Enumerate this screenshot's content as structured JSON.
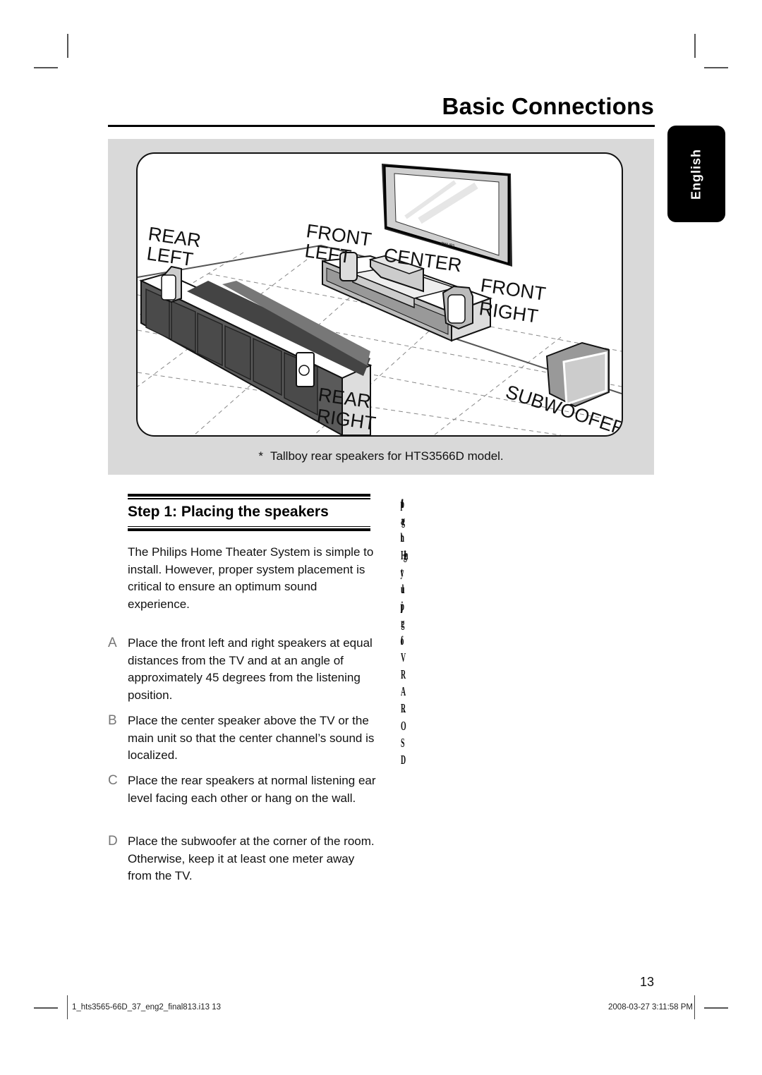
{
  "header": {
    "title": "Basic Connections",
    "language_tab": "English"
  },
  "figure": {
    "labels": {
      "rear_left": [
        "REAR",
        "LEFT"
      ],
      "front_left": [
        "FRONT",
        "LEFT"
      ],
      "center": "CENTER",
      "front_right": [
        "FRONT",
        "RIGHT"
      ],
      "rear_right": [
        "REAR",
        "RIGHT"
      ],
      "subwoofer": "SUBWOOFER",
      "tv_brand": "PHILIPS"
    },
    "caption_marker": "*",
    "caption": "Tallboy rear speakers for HTS3566D model."
  },
  "section": {
    "heading": "Step 1:  Placing the speakers",
    "intro": "The Philips Home Theater System is simple to install.  However, proper system placement is critical to ensure an optimum sound experience.",
    "items": [
      {
        "letter": "A",
        "text": "Place the front left and right speakers at equal distances from the TV and at an angle of approximately 45 degrees from the listening position."
      },
      {
        "letter": "B",
        "text": "Place the center speaker above the TV or the main unit so that the center channel’s sound is localized."
      },
      {
        "letter": "C",
        "text": "Place the rear speakers at normal listening ear level facing each other or hang on the wall."
      },
      {
        "letter": "D",
        "text": "Place the subwoofer at the corner of the room. Otherwise, keep it at least one meter away from the TV."
      }
    ]
  },
  "garbled_column": [
    "fpl",
    "ag",
    "th",
    "Hgh",
    "ty",
    "ul",
    "jp",
    "rg",
    "fo",
    "V",
    "R",
    "A",
    "R.",
    "O",
    "S",
    "D"
  ],
  "footer": {
    "page_number": "13",
    "file_info": "1_hts3565-66D_37_eng2_final813.i13   13",
    "timestamp": "2008-03-27   3:11:58 PM"
  }
}
